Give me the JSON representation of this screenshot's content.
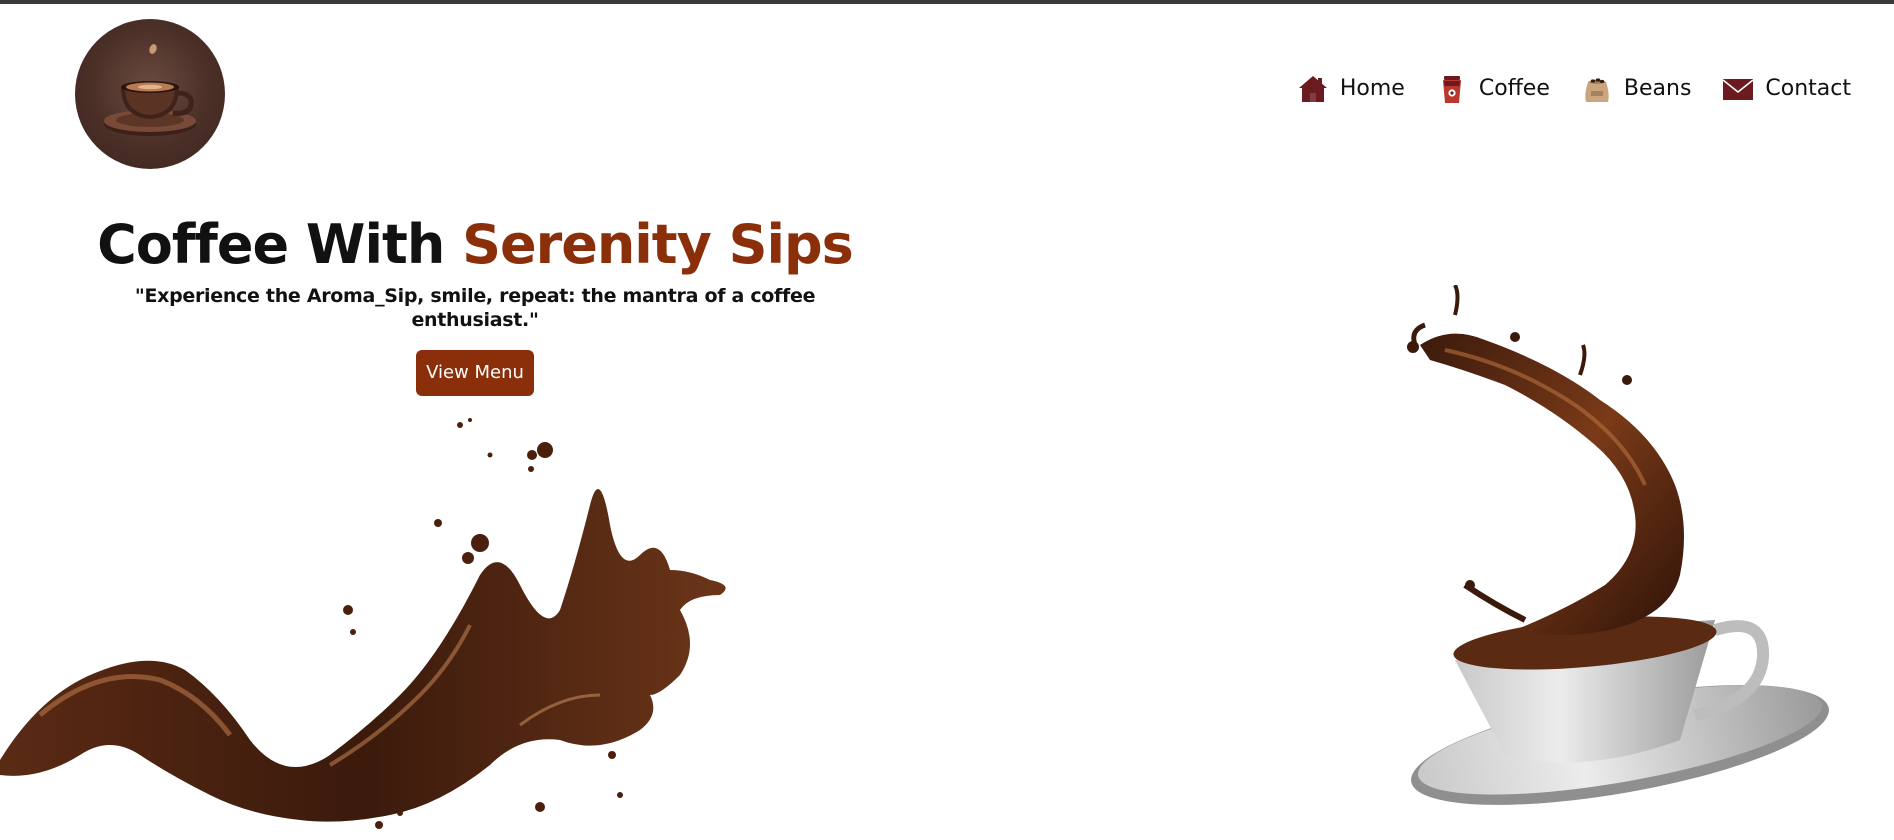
{
  "logo": {
    "icon": "coffee-cup-logo-icon"
  },
  "nav": {
    "items": [
      {
        "label": "Home",
        "icon": "home-icon"
      },
      {
        "label": "Coffee",
        "icon": "coffee-cup-icon"
      },
      {
        "label": "Beans",
        "icon": "coffee-beans-sack-icon"
      },
      {
        "label": "Contact",
        "icon": "envelope-icon"
      }
    ]
  },
  "hero": {
    "title_main": "Coffee With ",
    "title_accent": "Serenity Sips",
    "quote": "\"Experience the Aroma_Sip, smile, repeat: the mantra of a coffee enthusiast.\"",
    "button_label": "View Menu"
  },
  "colors": {
    "accent": "#8a2f0a",
    "nav_icon": "#6b1a1f",
    "top_bar": "#3a3a3a"
  }
}
